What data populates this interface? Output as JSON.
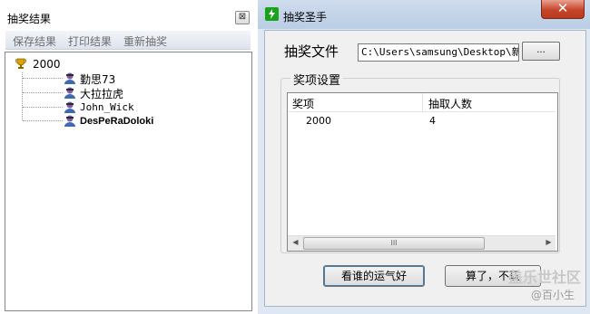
{
  "left_panel": {
    "title": "抽奖结果",
    "close_glyph": "⊠",
    "menu": [
      "保存结果",
      "打印结果",
      "重新抽奖"
    ],
    "tree": {
      "root_label": "2000",
      "root_icon": "trophy-icon",
      "children": [
        "勤思73",
        "大拉拉虎",
        "John_Wick",
        "DesPeRaDoloki"
      ],
      "child_icon": "person-icon"
    }
  },
  "main_window": {
    "title": "抽奖圣手",
    "close_glyph": "✕",
    "file_label": "抽奖文件",
    "file_path": "C:\\Users\\samsung\\Desktop\\新建",
    "browse_label": "...",
    "group_title": "奖项设置",
    "columns": [
      "奖项",
      "抽取人数"
    ],
    "rows": [
      [
        "2000",
        "4"
      ]
    ],
    "scroll_grip": "III",
    "go_button": "看谁的运气好",
    "quit_button": "算了，不玩"
  },
  "watermark": {
    "main": "盖乐世社区",
    "sub": "@百小生"
  },
  "colors": {
    "title_icon_green": "#1aa31a",
    "close_red": "#c6452a",
    "titlebar_blue": "#b9cde4"
  }
}
